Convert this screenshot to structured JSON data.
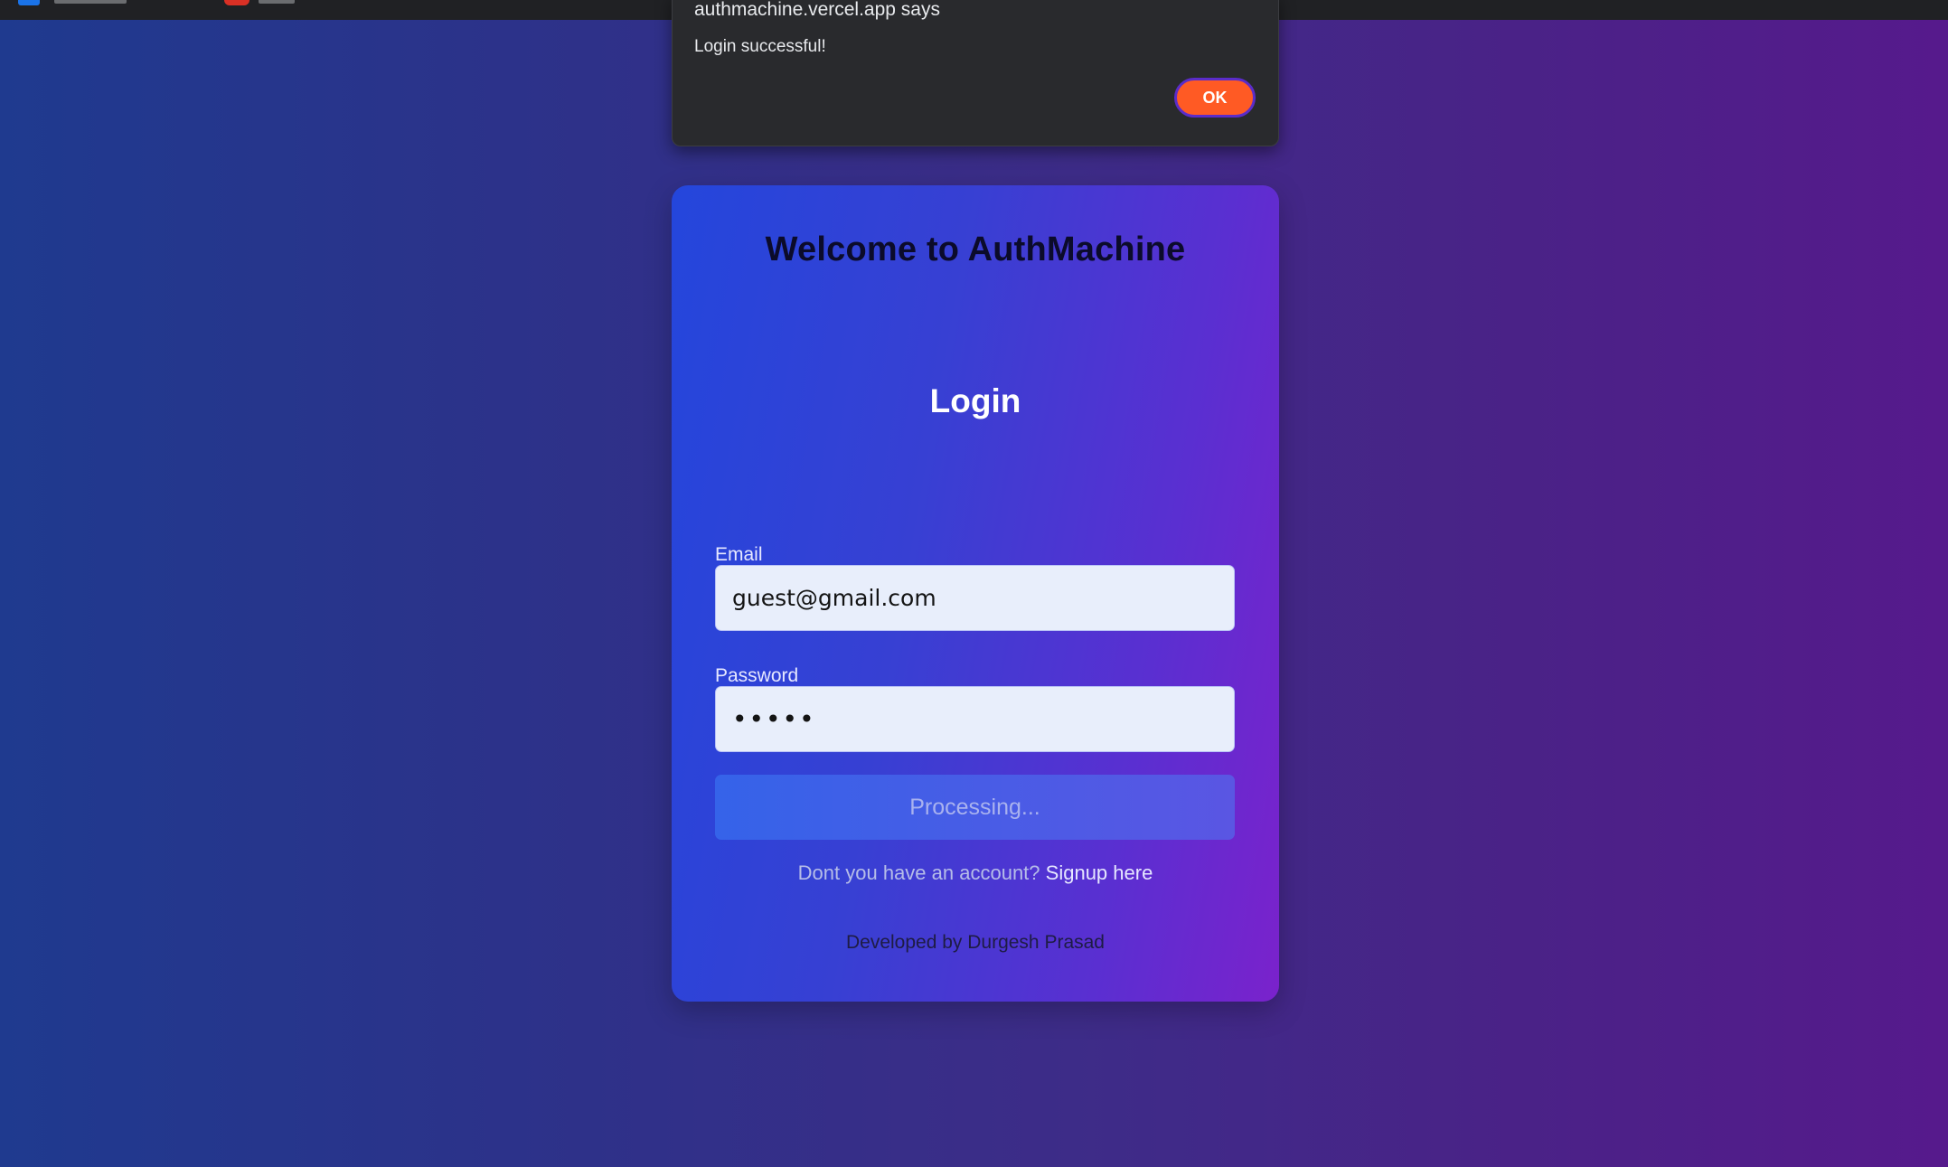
{
  "dialog": {
    "title": "authmachine.vercel.app says",
    "message": "Login successful!",
    "ok_label": "OK",
    "ok_color": "#ff5a24"
  },
  "card": {
    "welcome": "Welcome to AuthMachine",
    "login_title": "Login",
    "email": {
      "label": "Email",
      "value": "guest@gmail.com"
    },
    "password": {
      "label": "Password",
      "value": "•••••"
    },
    "submit_label": "Processing...",
    "signup_prompt": "Dont you have an account?",
    "signup_link": "Signup here",
    "credit": "Developed by Durgesh Prasad"
  },
  "colors": {
    "background_start": "#1f3a8f",
    "background_end": "#561a8c",
    "card_start": "#2446dc",
    "card_end": "#7a22cc"
  }
}
